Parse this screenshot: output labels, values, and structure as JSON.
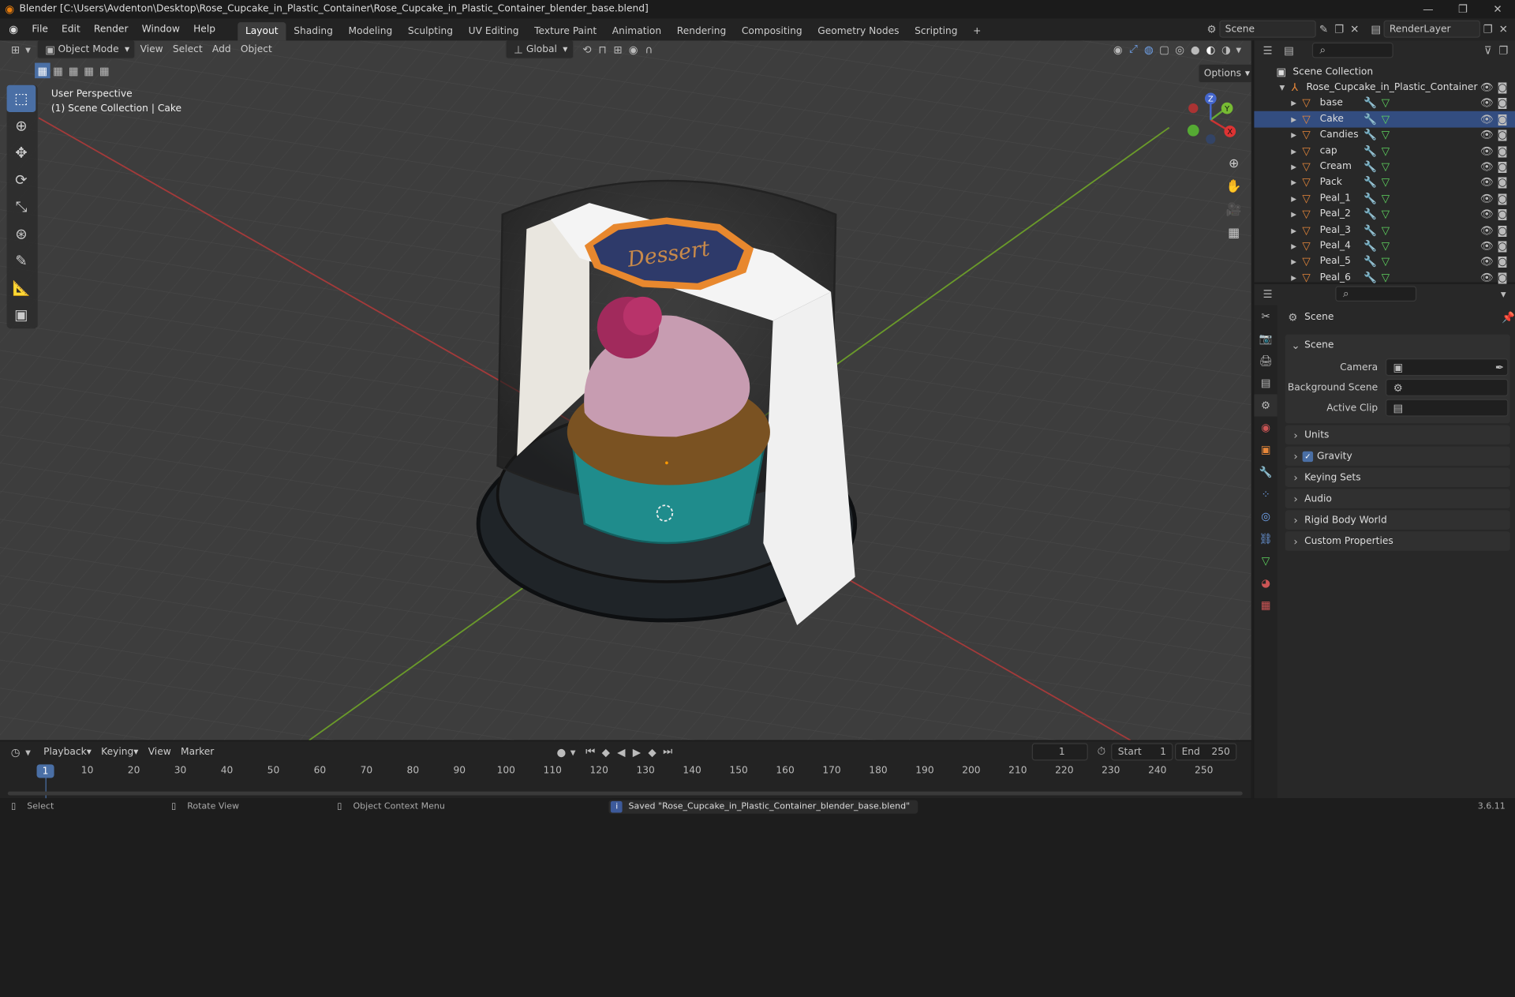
{
  "title": "Blender [C:\\Users\\Avdenton\\Desktop\\Rose_Cupcake_in_Plastic_Container\\Rose_Cupcake_in_Plastic_Container_blender_base.blend]",
  "menu": [
    "File",
    "Edit",
    "Render",
    "Window",
    "Help"
  ],
  "workspaces": [
    "Layout",
    "Shading",
    "Modeling",
    "Sculpting",
    "UV Editing",
    "Texture Paint",
    "Animation",
    "Rendering",
    "Compositing",
    "Geometry Nodes",
    "Scripting"
  ],
  "active_workspace": "Layout",
  "scene_name": "Scene",
  "view_layer": "RenderLayer",
  "viewport": {
    "mode": "Object Mode",
    "menus": [
      "View",
      "Select",
      "Add",
      "Object"
    ],
    "transform_orientation": "Global",
    "options_label": "Options",
    "perspective_label": "User Perspective",
    "collection_label": "(1) Scene Collection | Cake",
    "label_text": "Dessert",
    "axes": {
      "x": "X",
      "y": "Y",
      "z": "Z"
    }
  },
  "outliner": {
    "root": "Scene Collection",
    "collection": "Rose_Cupcake_in_Plastic_Container",
    "objects": [
      "base",
      "Cake",
      "Candies",
      "cap",
      "Cream",
      "Pack",
      "Peal_1",
      "Peal_2",
      "Peal_3",
      "Peal_4",
      "Peal_5",
      "Peal_6"
    ],
    "selected": "Cake"
  },
  "properties": {
    "context": "Scene",
    "section": "Scene",
    "camera_label": "Camera",
    "background_scene_label": "Background Scene",
    "active_clip_label": "Active Clip",
    "panels": [
      "Units",
      "Gravity",
      "Keying Sets",
      "Audio",
      "Rigid Body World",
      "Custom Properties"
    ],
    "gravity_checked": true
  },
  "timeline": {
    "menus": [
      "Playback",
      "Keying",
      "View",
      "Marker"
    ],
    "current_frame": "1",
    "start_label": "Start",
    "start_value": "1",
    "end_label": "End",
    "end_value": "250",
    "ticks": [
      "10",
      "20",
      "30",
      "40",
      "50",
      "60",
      "70",
      "80",
      "90",
      "100",
      "110",
      "120",
      "130",
      "140",
      "150",
      "160",
      "170",
      "180",
      "190",
      "200",
      "210",
      "220",
      "230",
      "240",
      "250"
    ],
    "playhead": "1"
  },
  "status": {
    "select": "Select",
    "rotate": "Rotate View",
    "context_menu": "Object Context Menu",
    "message": "Saved \"Rose_Cupcake_in_Plastic_Container_blender_base.blend\"",
    "version": "3.6.11"
  },
  "colors": {
    "accent": "#4a6fa5",
    "object_orange": "#e8883a",
    "mesh_green": "#5fd45f",
    "modifier_blue": "#6fa0e8"
  }
}
